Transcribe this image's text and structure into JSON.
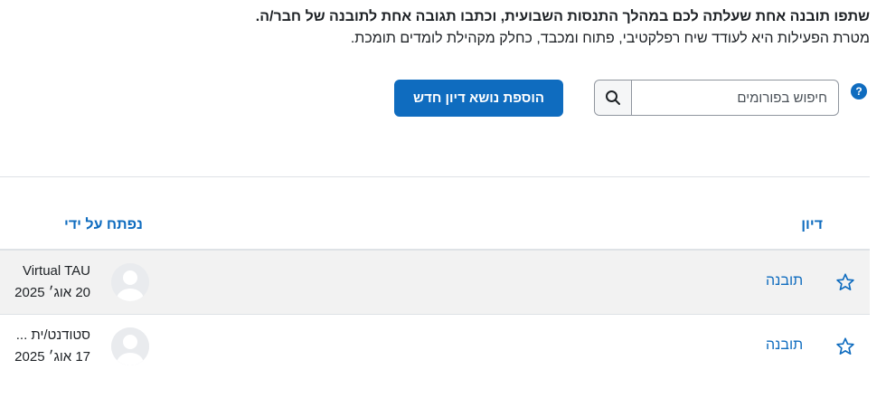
{
  "intro": {
    "instruction": "שתפו תובנה אחת שעלתה לכם במהלך התנסות השבועית, וכתבו תגובה אחת לתובנה של חבר/ה.",
    "purpose": "מטרת הפעילות היא לעודד שיח רפלקטיבי, פתוח ומכבד, כחלק מקהילת לומדים תומכת."
  },
  "help_icon": "?",
  "search": {
    "placeholder": "חיפוש בפורומים"
  },
  "add_topic_label": "הוספת נושא דיון חדש",
  "table": {
    "headers": {
      "discussion": "דיון",
      "started_by": "נפתח על ידי"
    },
    "rows": [
      {
        "topic": "תובנה",
        "author": "Virtual TAU",
        "date": "20 אוג׳ 2025"
      },
      {
        "topic": "תובנה",
        "author": "סטודנט/ית ...",
        "date": "17 אוג׳ 2025"
      }
    ]
  },
  "icons": {
    "star": "star-outline-icon",
    "search": "magnifier-icon",
    "help": "question-circle-icon",
    "avatar": "user-placeholder-icon"
  },
  "colors": {
    "primary": "#0f6cbf",
    "row_highlight": "#f2f2f2",
    "border": "#dee2e6"
  }
}
